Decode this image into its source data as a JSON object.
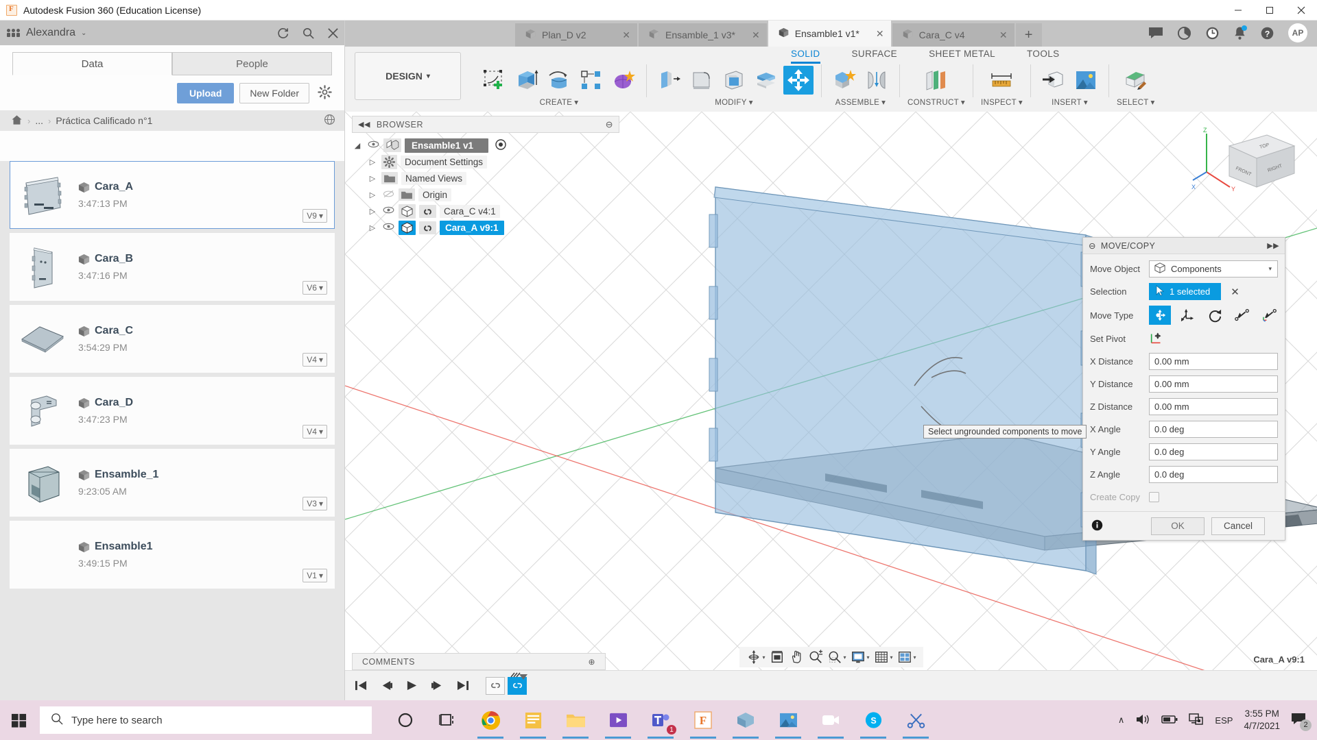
{
  "window": {
    "title": "Autodesk Fusion 360 (Education License)",
    "minimize": "–",
    "maximize": "□",
    "close": "✕"
  },
  "data_panel": {
    "user": "Alexandra",
    "user_caret": "⌄",
    "refresh_icon": "refresh-icon",
    "search_icon": "search-icon",
    "close_icon": "✕",
    "tabs": [
      {
        "label": "Data",
        "active": true
      },
      {
        "label": "People",
        "active": false
      }
    ],
    "upload_label": "Upload",
    "new_folder_label": "New Folder",
    "gear_icon": "gear-icon",
    "breadcrumb": {
      "home_icon": "home-icon",
      "ellipsis": "...",
      "current": "Práctica Calificado n°1",
      "separator": "›",
      "globe_icon": "globe-icon"
    },
    "files": [
      {
        "name": "Cara_A",
        "time": "3:47:13 PM",
        "version": "V9",
        "selected": true,
        "thumb": "panel-plate"
      },
      {
        "name": "Cara_B",
        "time": "3:47:16 PM",
        "version": "V6",
        "selected": false,
        "thumb": "tall-plate"
      },
      {
        "name": "Cara_C",
        "time": "3:54:29 PM",
        "version": "V4",
        "selected": false,
        "thumb": "flat-plate"
      },
      {
        "name": "Cara_D",
        "time": "3:47:23 PM",
        "version": "V4",
        "selected": false,
        "thumb": "bracket"
      },
      {
        "name": "Ensamble_1",
        "time": "9:23:05 AM",
        "version": "V3",
        "selected": false,
        "thumb": "box-assembly"
      },
      {
        "name": "Ensamble1",
        "time": "3:49:15 PM",
        "version": "V1",
        "selected": false,
        "thumb": "none"
      }
    ],
    "version_caret": "▾"
  },
  "doc_tabs": {
    "tabs": [
      {
        "label": "Plan_D v2",
        "active": false,
        "close": "✕"
      },
      {
        "label": "Ensamble_1 v3*",
        "active": false,
        "close": "✕"
      },
      {
        "label": "Ensamble1 v1*",
        "active": true,
        "close": "✕"
      },
      {
        "label": "Cara_C v4",
        "active": false,
        "close": "✕"
      }
    ],
    "new_tab": "+",
    "right_icons": [
      "comment-icon",
      "help-circle-icon",
      "job-status-icon",
      "notifications-bell-icon",
      "question-help-icon"
    ],
    "avatar_initials": "AP"
  },
  "ribbon": {
    "workspace": "DESIGN",
    "workspace_caret": "▾",
    "tabs": [
      {
        "label": "SOLID",
        "active": true
      },
      {
        "label": "SURFACE",
        "active": false
      },
      {
        "label": "SHEET METAL",
        "active": false
      },
      {
        "label": "TOOLS",
        "active": false
      }
    ],
    "groups": [
      {
        "label": "CREATE",
        "caret": "▾",
        "tools": [
          "create-sketch-icon",
          "extrude-icon",
          "revolve-icon",
          "pattern-icon",
          "form-icon"
        ]
      },
      {
        "label": "MODIFY",
        "caret": "▾",
        "tools": [
          "press-pull-icon",
          "fillet-icon",
          "shell-icon",
          "offset-face-icon",
          "move-copy-icon"
        ]
      },
      {
        "label": "ASSEMBLE",
        "caret": "▾",
        "tools": [
          "new-component-icon",
          "joint-icon"
        ]
      },
      {
        "label": "CONSTRUCT",
        "caret": "▾",
        "tools": [
          "offset-plane-icon"
        ]
      },
      {
        "label": "INSPECT",
        "caret": "▾",
        "tools": [
          "measure-icon"
        ]
      },
      {
        "label": "INSERT",
        "caret": "▾",
        "tools": [
          "insert-derive-icon",
          "insert-canvas-icon"
        ]
      },
      {
        "label": "SELECT",
        "caret": "▾",
        "tools": [
          "select-paint-icon"
        ]
      }
    ],
    "active_tool": "move-copy-icon"
  },
  "browser": {
    "title": "BROWSER",
    "collapse_icon": "◀◀",
    "minimize_icon": "⊖",
    "expand_icon": "▶▶",
    "nodes": [
      {
        "label": "Ensamble1 v1",
        "indent": 0,
        "type": "root",
        "twisty": "◢",
        "eye": true,
        "icon": "assembly-icon",
        "badge": "target-icon",
        "selected": false
      },
      {
        "label": "Document Settings",
        "indent": 1,
        "type": "folder",
        "twisty": "▷",
        "eye": false,
        "icon": "gear-icon",
        "selected": false
      },
      {
        "label": "Named Views",
        "indent": 1,
        "type": "folder",
        "twisty": "▷",
        "eye": false,
        "icon": "folder-icon",
        "selected": false
      },
      {
        "label": "Origin",
        "indent": 1,
        "type": "folder",
        "twisty": "▷",
        "eye": false,
        "icon": "folder-icon",
        "hidden_eye": true,
        "selected": false
      },
      {
        "label": "Cara_C v4:1",
        "indent": 1,
        "type": "component",
        "twisty": "▷",
        "eye": true,
        "icon": "body-icon",
        "link": true,
        "selected": false
      },
      {
        "label": "Cara_A v9:1",
        "indent": 1,
        "type": "component",
        "twisty": "▷",
        "eye": true,
        "icon": "body-icon",
        "link": true,
        "selected": true
      }
    ]
  },
  "move_copy": {
    "title": "MOVE/COPY",
    "stop_icon": "⊖",
    "expand_icon": "▶▶",
    "move_object": {
      "label": "Move Object",
      "value": "Components",
      "icon": "body-icon",
      "caret": "▾"
    },
    "selection": {
      "label": "Selection",
      "value": "1 selected",
      "cursor_icon": "cursor-icon",
      "clear": "✕"
    },
    "move_type": {
      "label": "Move Type",
      "options": [
        "free-move-icon",
        "translate-icon",
        "rotate-icon",
        "point-to-point-icon",
        "point-to-position-icon"
      ],
      "selected_index": 0
    },
    "set_pivot": {
      "label": "Set Pivot",
      "icon": "set-pivot-icon"
    },
    "fields": [
      {
        "label": "X Distance",
        "value": "0.00 mm"
      },
      {
        "label": "Y Distance",
        "value": "0.00 mm"
      },
      {
        "label": "X Angle",
        "value": "0.0 deg"
      },
      {
        "label": "Y Angle",
        "value": "0.0 deg"
      },
      {
        "label": "Z Angle",
        "value": "0.0 deg"
      }
    ],
    "z_distance": {
      "label": "Z Distance",
      "value": "0.00 mm"
    },
    "create_copy": {
      "label": "Create Copy",
      "checked": false
    },
    "info_icon": "info-icon",
    "ok_label": "OK",
    "cancel_label": "Cancel",
    "tooltip": "Select ungrounded components to move"
  },
  "canvas": {
    "comments_label": "COMMENTS",
    "comments_add": "⊕",
    "active_component_label": "Cara_A v9:1",
    "viewcube": {
      "top": "TOP",
      "front": "FRONT",
      "right": "RIGHT",
      "axis_z": "Z",
      "axis_y": "Y",
      "axis_x": "X"
    },
    "view_tools": [
      "orbit-icon",
      "display-settings-icon",
      "pan-icon",
      "zoom-icon",
      "fit-icon",
      "display-mode-icon",
      "grid-snap-icon",
      "viewport-layout-icon"
    ],
    "timeline_buttons": [
      "jump-start-icon",
      "step-back-icon",
      "play-icon",
      "step-forward-icon",
      "jump-end-icon"
    ],
    "timeline_features": [
      "joint-feature-icon",
      "joint-feature-active-icon"
    ]
  },
  "taskbar": {
    "start_icon": "windows-start-icon",
    "search_placeholder": "Type here to search",
    "search_icon": "search-icon",
    "apps": [
      {
        "name": "cortana-icon",
        "active": false
      },
      {
        "name": "task-view-icon",
        "active": false
      },
      {
        "name": "chrome-icon",
        "active": true
      },
      {
        "name": "sticky-notes-icon",
        "active": true
      },
      {
        "name": "file-explorer-icon",
        "active": true
      },
      {
        "name": "media-player-icon",
        "active": true
      },
      {
        "name": "teams-icon",
        "active": true,
        "badge": "1"
      },
      {
        "name": "fusion360-icon",
        "active": true
      },
      {
        "name": "autodesk-app-icon",
        "active": true
      },
      {
        "name": "photos-icon",
        "active": true
      },
      {
        "name": "zoom-meeting-icon",
        "active": true
      },
      {
        "name": "skype-icon",
        "active": true
      },
      {
        "name": "scissors-icon",
        "active": true
      }
    ],
    "tray": {
      "chevron": "∧",
      "volume_icon": "volume-icon",
      "battery_icon": "battery-icon",
      "network_icon": "network-icon",
      "language": "ESP",
      "time": "3:55 PM",
      "date": "4/7/2021",
      "notification_count": "2"
    }
  }
}
